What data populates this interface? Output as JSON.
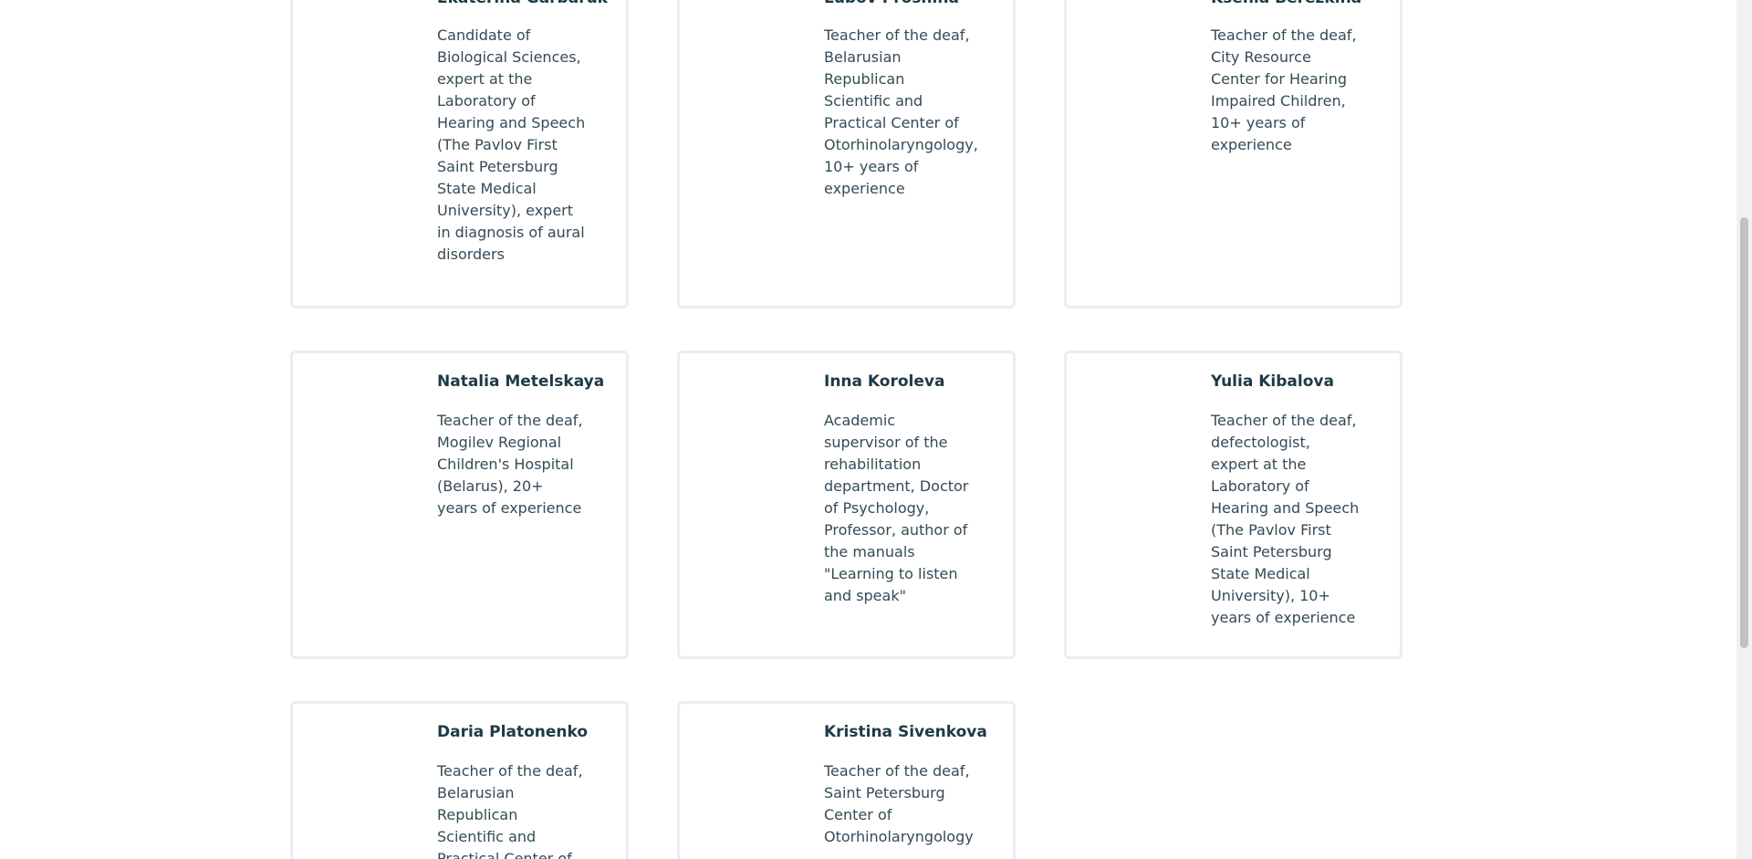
{
  "team": {
    "members": [
      {
        "name": "Ekaterina Garbaruk",
        "description": "Candidate of Biological Sciences, expert at the Laboratory of Hearing and Speech (The Pavlov First Saint Petersburg State Medical University), expert in diagnosis of aural disorders"
      },
      {
        "name": "Lubov Proshina",
        "description": "Teacher of the deaf, Belarusian Republican Scientific and Practical Center of Otorhinolaryngology, 10+ years of experience"
      },
      {
        "name": "Ksenia Berezkina",
        "description": "Teacher of the deaf, City Resource Center for Hearing Impaired Children, 10+ years of experience"
      },
      {
        "name": "Natalia Metelskaya",
        "description": "Teacher of the deaf, Mogilev Regional Children's Hospital (Belarus), 20+ years of experience"
      },
      {
        "name": "Inna Koroleva",
        "description": "Academic supervisor of the rehabilitation department, Doctor of Psychology, Professor, author of the manuals \"Learning to listen and speak\""
      },
      {
        "name": "Yulia Kibalova",
        "description": "Teacher of the deaf, defectologist, expert at the Laboratory of Hearing and Speech (The Pavlov First Saint Petersburg State Medical University), 10+ years of experience"
      },
      {
        "name": "Daria Platonenko",
        "description": "Teacher of the deaf, Belarusian Republican Scientific and Practical Center of Otorhinolaryngology"
      },
      {
        "name": "Kristina Sivenkova",
        "description": "Teacher of the deaf, Saint Petersburg Center of Otorhinolaryngology"
      }
    ]
  }
}
